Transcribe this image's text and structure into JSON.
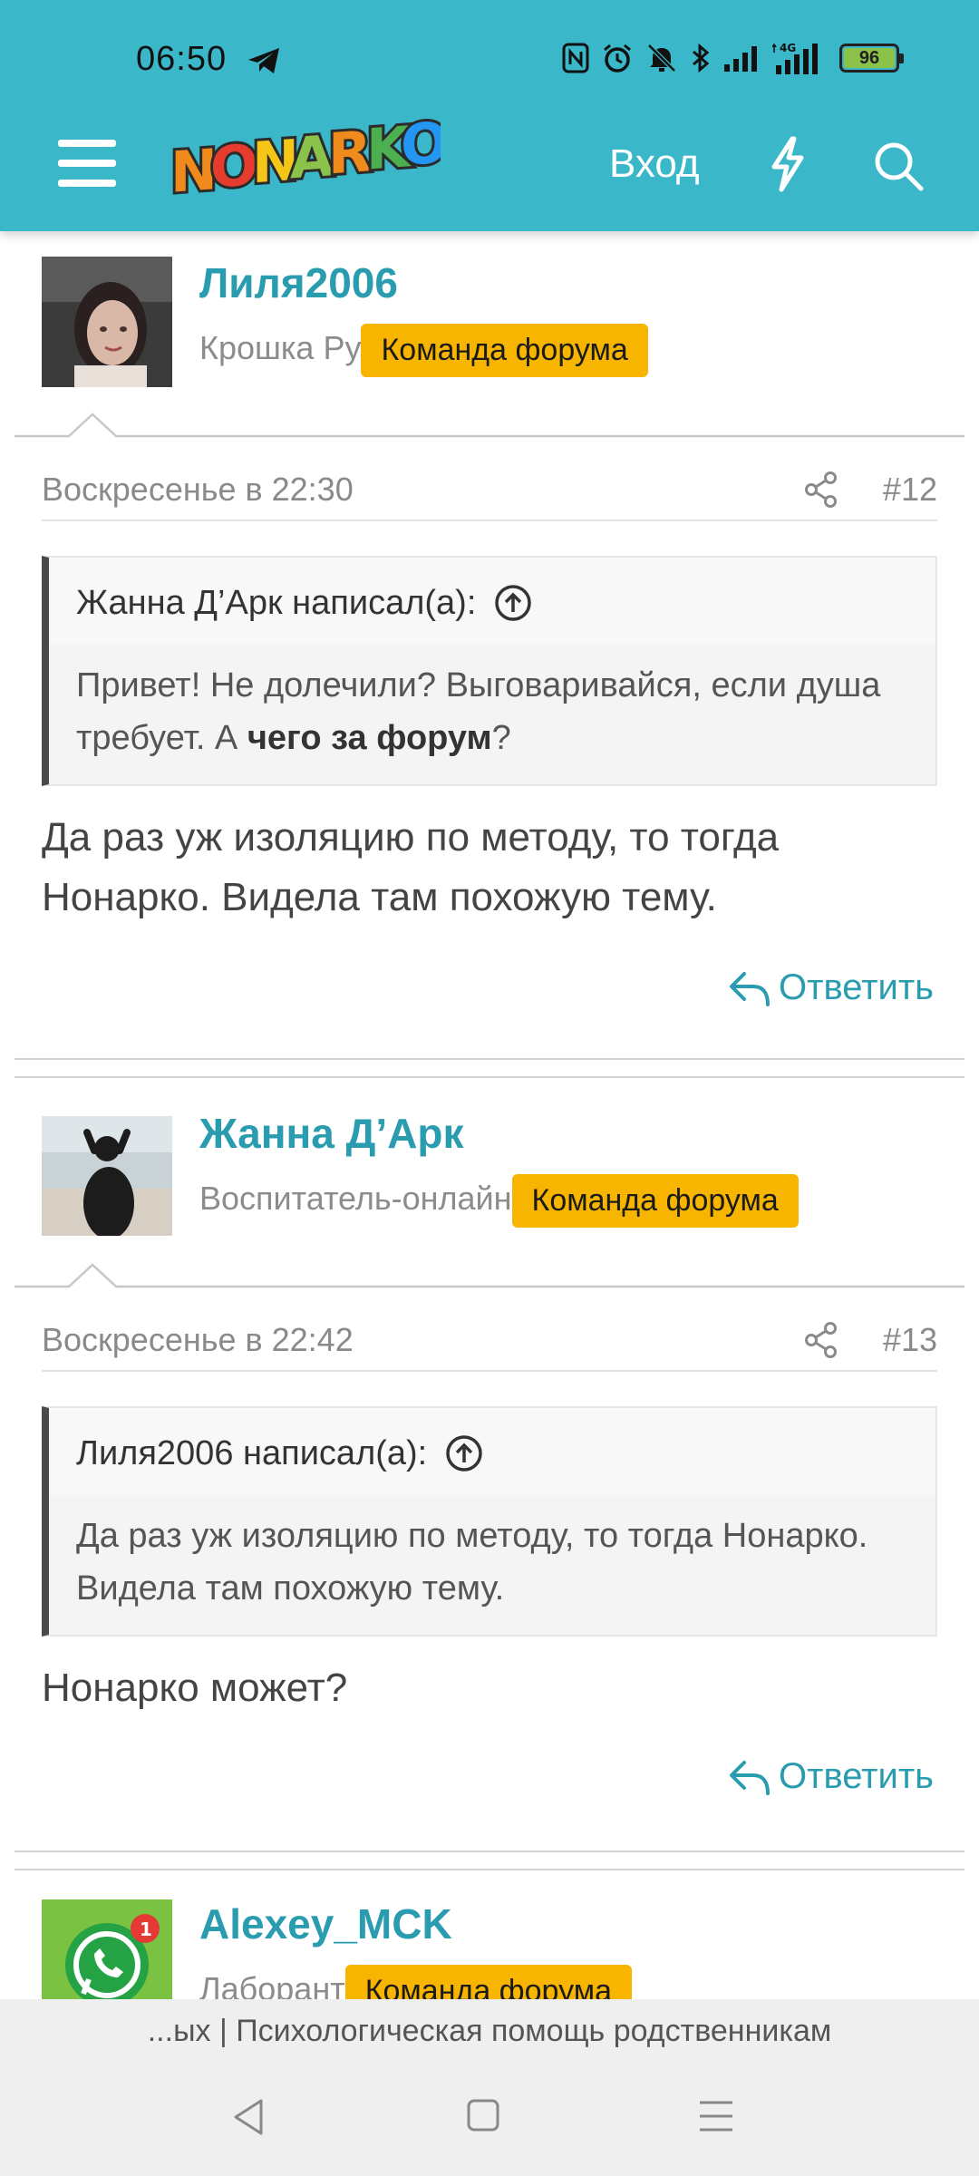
{
  "status_bar": {
    "time": "06:50",
    "battery": "96",
    "network": "4G"
  },
  "app_bar": {
    "logo_text": "NONARKO",
    "login_label": "Вход"
  },
  "posts": [
    {
      "username": "Лиля2006",
      "user_title": "Крошка Ру",
      "badge": "Команда форума",
      "date": "Воскресенье в 22:30",
      "number": "#12",
      "quote_author": "Жанна Д’Арк написал(а):",
      "quote_text_1": "Привет! Не долечили? Выговаривайся, если душа требует. А ",
      "quote_text_bold": "чего за форум",
      "quote_text_2": "?",
      "message": "Да раз уж изоляцию по методу, то тогда Нонарко. Видела там похожую тему.",
      "reply_label": "Ответить"
    },
    {
      "username": "Жанна Д’Арк",
      "user_title": "Воспитатель-онлайн",
      "badge": "Команда форума",
      "date": "Воскресенье в 22:42",
      "number": "#13",
      "quote_author": "Лиля2006 написал(а):",
      "quote_text": "Да раз уж изоляцию по методу, то тогда Нонарко. Видела там похожую тему.",
      "message": "Нонарко может?",
      "reply_label": "Ответить"
    },
    {
      "username": "Alexey_MCK",
      "user_title": "Лаборант",
      "badge": "Команда форума",
      "notification_count": "1"
    }
  ],
  "footer": {
    "text": "...ых | Психологическая помощь родственникам"
  },
  "colors": {
    "header": "#3ab7c8",
    "accent": "#2a9cb0",
    "badge": "#f7b500"
  }
}
